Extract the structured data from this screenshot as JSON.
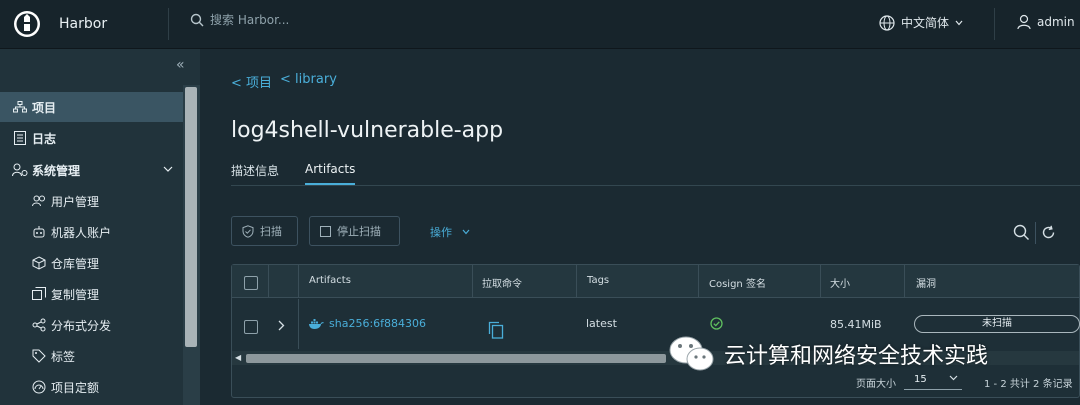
{
  "header": {
    "brand": "Harbor",
    "search_placeholder": "搜索 Harbor...",
    "language": "中文简体",
    "user": "admin"
  },
  "sidebar": {
    "items": [
      {
        "label": "项目",
        "icon": "projects-icon",
        "active": true
      },
      {
        "label": "日志",
        "icon": "logs-icon"
      },
      {
        "label": "系统管理",
        "icon": "system-admin-icon",
        "expanded": true
      }
    ],
    "sub_items": [
      {
        "label": "用户管理",
        "icon": "users-icon"
      },
      {
        "label": "机器人账户",
        "icon": "robot-icon"
      },
      {
        "label": "仓库管理",
        "icon": "registry-icon"
      },
      {
        "label": "复制管理",
        "icon": "replication-icon"
      },
      {
        "label": "分布式分发",
        "icon": "distribution-icon"
      },
      {
        "label": "标签",
        "icon": "tag-icon"
      },
      {
        "label": "项目定额",
        "icon": "quota-icon"
      }
    ]
  },
  "breadcrumb": {
    "items": [
      "< 项目",
      "< library"
    ]
  },
  "repository": {
    "title": "log4shell-vulnerable-app",
    "tabs": [
      {
        "label": "描述信息",
        "active": false
      },
      {
        "label": "Artifacts",
        "active": true
      }
    ]
  },
  "toolbar": {
    "scan_label": "扫描",
    "stop_scan_label": "停止扫描",
    "actions_label": "操作"
  },
  "table": {
    "columns": [
      "Artifacts",
      "拉取命令",
      "Tags",
      "Cosign 签名",
      "大小",
      "漏洞"
    ],
    "rows": [
      {
        "artifact": "sha256:6f884306",
        "tags": "latest",
        "cosign_signed": true,
        "size": "85.41MiB",
        "vulnerabilities": "未扫描"
      }
    ],
    "page_size_label": "页面大小",
    "page_size": "15",
    "records": "1 - 2 共计 2 条记录"
  },
  "watermark": {
    "text": "云计算和网络安全技术实践"
  },
  "colors": {
    "accent": "#4aaed9",
    "success": "#5fbf5f",
    "header_bg": "#17242b",
    "sidebar_bg": "#21333b",
    "main_bg": "#1b2a32"
  }
}
